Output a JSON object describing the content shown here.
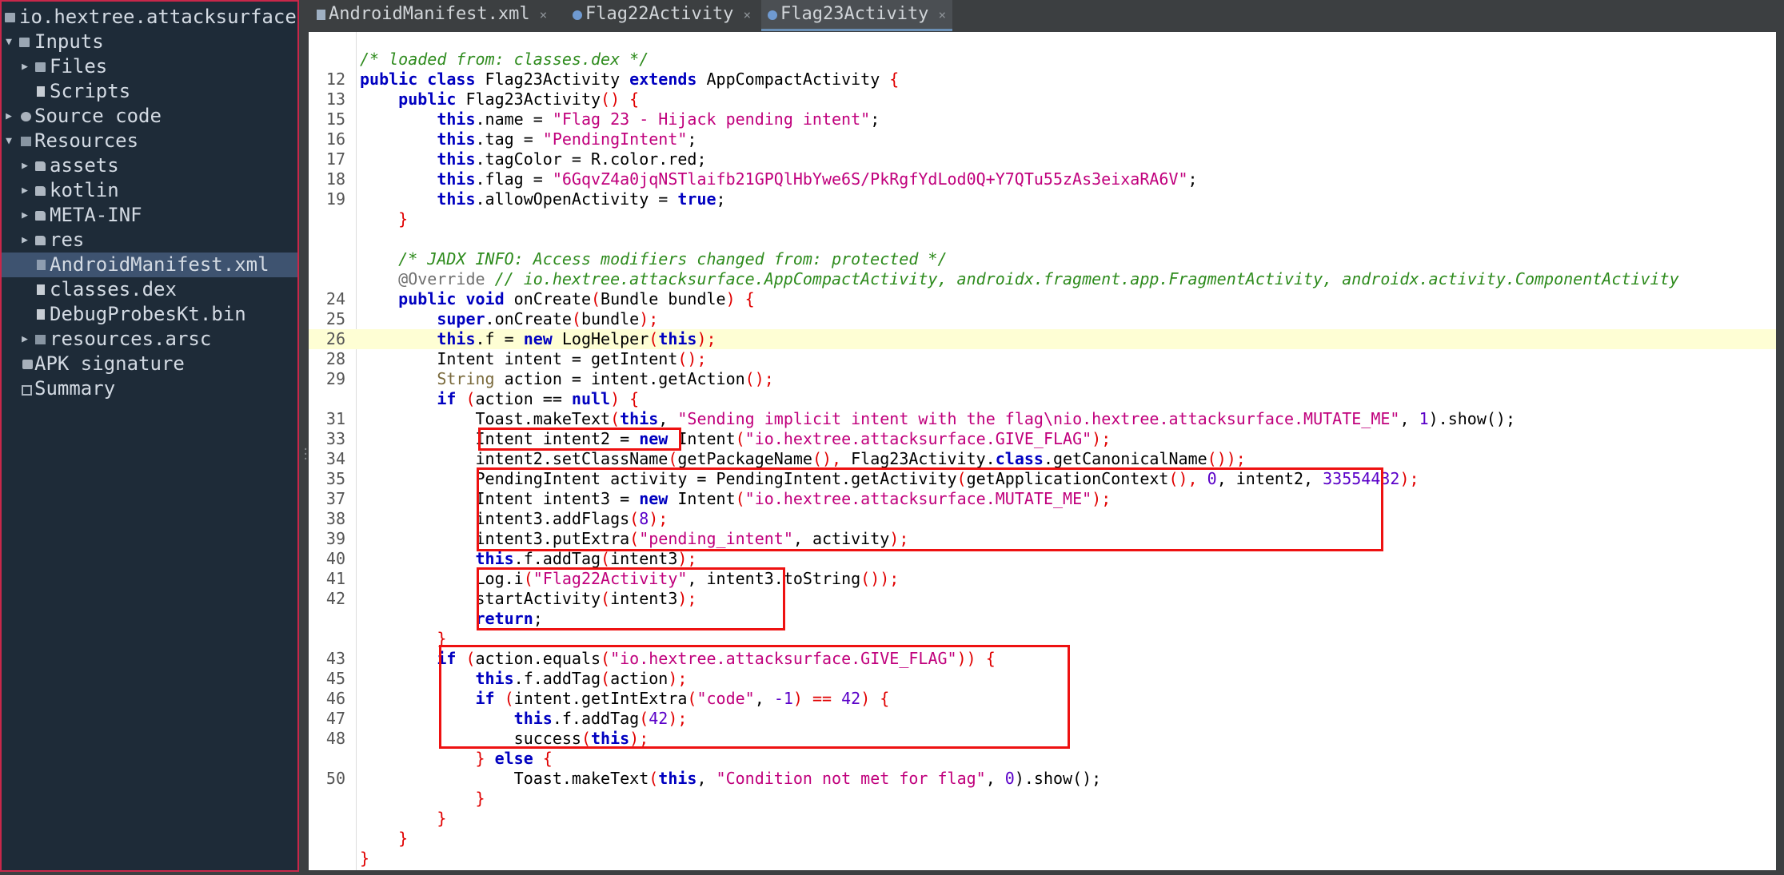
{
  "tree": {
    "root": "io.hextree.attacksurface.",
    "inputs": "Inputs",
    "files": "Files",
    "scripts": "Scripts",
    "source_code": "Source code",
    "resources": "Resources",
    "assets": "assets",
    "kotlin": "kotlin",
    "meta_inf": "META-INF",
    "res": "res",
    "manifest": "AndroidManifest.xml",
    "classes_dex": "classes.dex",
    "debug_probes": "DebugProbesKt.bin",
    "resources_arsc": "resources.arsc",
    "apk_signature": "APK signature",
    "summary": "Summary"
  },
  "tabs": [
    {
      "label": "AndroidManifest.xml"
    },
    {
      "label": "Flag22Activity"
    },
    {
      "label": "Flag23Activity"
    }
  ],
  "tab_close_glyph": "×",
  "code": {
    "l0": {
      "ln": "",
      "t1": "/* loaded from: classes.dex */"
    },
    "l1": {
      "ln": "12",
      "t1": "public class ",
      "t2": "Flag23Activity ",
      "t3": "extends ",
      "t4": "AppCompactActivity ",
      "t5": "{"
    },
    "l2": {
      "ln": "13",
      "t1": "    public ",
      "t2": "Flag23Activity",
      "t3": "() {"
    },
    "l3": {
      "ln": "15",
      "t1": "        this",
      "t2": ".name = ",
      "t3": "\"Flag 23 - Hijack pending intent\"",
      "t4": ";"
    },
    "l4": {
      "ln": "16",
      "t1": "        this",
      "t2": ".tag = ",
      "t3": "\"PendingIntent\"",
      "t4": ";"
    },
    "l5": {
      "ln": "17",
      "t1": "        this",
      "t2": ".tagColor = R.color.red;"
    },
    "l6": {
      "ln": "18",
      "t1": "        this",
      "t2": ".flag = ",
      "t3": "\"6GqvZ4a0jqNSTlaifb21GPQlHbYwe6S/PkRgfYdLod0Q+Y7QTu55zAs3eixaRA6V\"",
      "t4": ";"
    },
    "l7": {
      "ln": "19",
      "t1": "        this",
      "t2": ".allowOpenActivity = ",
      "t3": "true",
      "t4": ";"
    },
    "l8": {
      "ln": "",
      "t1": "    }"
    },
    "l9": {
      "ln": "",
      "t1": ""
    },
    "l10": {
      "ln": "",
      "t1": "    /* JADX INFO: Access modifiers changed from: protected */"
    },
    "l11": {
      "ln": "",
      "t1": "    @Override ",
      "t2": "// io.hextree.attacksurface.AppCompactActivity, androidx.fragment.app.FragmentActivity, androidx.activity.ComponentActivity"
    },
    "l12": {
      "ln": "24",
      "t1": "    public void ",
      "t2": "onCreate",
      "t3": "(",
      "t4": "Bundle bundle",
      "t5": ") {"
    },
    "l13": {
      "ln": "25",
      "t1": "        super",
      "t2": ".onCreate",
      "t3": "(",
      "t4": "bundle",
      "t5": ");"
    },
    "l14": {
      "ln": "26",
      "t1": "        this",
      "t2": ".f = ",
      "t3": "new ",
      "t4": "LogHelper",
      "t5": "(",
      "t6": "this",
      "t7": ");"
    },
    "l15": {
      "ln": "28",
      "t1": "        Intent intent = getIntent",
      "t2": "();"
    },
    "l16": {
      "ln": "29",
      "t1": "        String ",
      "t2": "action = intent.getAction",
      "t3": "();"
    },
    "l17": {
      "ln": "",
      "t1": "        if ",
      "t2": "(",
      "t3": "action == ",
      "t4": "null",
      "t5": ") {"
    },
    "l18": {
      "ln": "31",
      "t1": "            Toast.makeText",
      "t2": "(",
      "t3": "this",
      "t4": ", ",
      "t5": "\"Sending implicit intent with the flag\\nio.hextree.attacksurface.MUTATE_ME\"",
      "t6": ", ",
      "t7": "1",
      "t8": ").show();"
    },
    "l19": {
      "ln": "33",
      "t1": "            Intent intent2 = ",
      "t2": "new ",
      "t3": "Intent",
      "t4": "(",
      "t5": "\"io.hextree.attacksurface.GIVE_FLAG\"",
      "t6": ");"
    },
    "l20": {
      "ln": "34",
      "t1": "            intent2.setClassName",
      "t2": "(",
      "t3": "getPackageName",
      "t4": "(), ",
      "t5": "Flag23Activity.",
      "t6": "class",
      "t7": ".getCanonicalName",
      "t8": "());"
    },
    "l21": {
      "ln": "35",
      "t1": "            PendingIntent activity = PendingIntent.getActivity",
      "t2": "(",
      "t3": "getApplicationContext",
      "t4": "(), ",
      "t5": "0",
      "t6": ", intent2, ",
      "t7": "33554432",
      "t8": ");"
    },
    "l22": {
      "ln": "37",
      "t1": "            Intent intent3 = ",
      "t2": "new ",
      "t3": "Intent",
      "t4": "(",
      "t5": "\"io.hextree.attacksurface.MUTATE_ME\"",
      "t6": ");"
    },
    "l23": {
      "ln": "38",
      "t1": "            intent3.addFlags",
      "t2": "(",
      "t3": "8",
      "t4": ");"
    },
    "l24": {
      "ln": "39",
      "t1": "            intent3.putExtra",
      "t2": "(",
      "t3": "\"pending_intent\"",
      "t4": ", activity",
      "t5": ");"
    },
    "l25": {
      "ln": "40",
      "t1": "            this",
      "t2": ".f.addTag",
      "t3": "(",
      "t4": "intent3",
      "t5": ");"
    },
    "l26": {
      "ln": "41",
      "t1": "            Log.i",
      "t2": "(",
      "t3": "\"Flag22Activity\"",
      "t4": ", intent3.toString",
      "t5": "());"
    },
    "l27": {
      "ln": "42",
      "t1": "            startActivity",
      "t2": "(",
      "t3": "intent3",
      "t4": ");"
    },
    "l28": {
      "ln": "",
      "t1": "            return",
      "t2": ";"
    },
    "l29": {
      "ln": "",
      "t1": "        }"
    },
    "l30": {
      "ln": "43",
      "t1": "        if ",
      "t2": "(",
      "t3": "action.equals",
      "t4": "(",
      "t5": "\"io.hextree.attacksurface.GIVE_FLAG\"",
      "t6": ")) {"
    },
    "l31": {
      "ln": "45",
      "t1": "            this",
      "t2": ".f.addTag",
      "t3": "(",
      "t4": "action",
      "t5": ");"
    },
    "l32": {
      "ln": "46",
      "t1": "            if ",
      "t2": "(",
      "t3": "intent.getIntExtra",
      "t4": "(",
      "t5": "\"code\"",
      "t6": ", ",
      "t7": "-1",
      "t8": ") == ",
      "t9": "42",
      "t10": ") {"
    },
    "l33": {
      "ln": "47",
      "t1": "                this",
      "t2": ".f.addTag",
      "t3": "(",
      "t4": "42",
      "t5": ");"
    },
    "l34": {
      "ln": "48",
      "t1": "                success",
      "t2": "(",
      "t3": "this",
      "t4": ");"
    },
    "l35": {
      "ln": "",
      "t1": "            } ",
      "t2": "else ",
      "t3": "{"
    },
    "l36": {
      "ln": "50",
      "t1": "                Toast.makeText",
      "t2": "(",
      "t3": "this",
      "t4": ", ",
      "t5": "\"Condition not met for flag\"",
      "t6": ", ",
      "t7": "0",
      "t8": ").show();"
    },
    "l37": {
      "ln": "",
      "t1": "            }"
    },
    "l38": {
      "ln": "",
      "t1": "        }"
    },
    "l39": {
      "ln": "",
      "t1": "    }"
    },
    "l40": {
      "ln": "",
      "t1": "}"
    }
  }
}
